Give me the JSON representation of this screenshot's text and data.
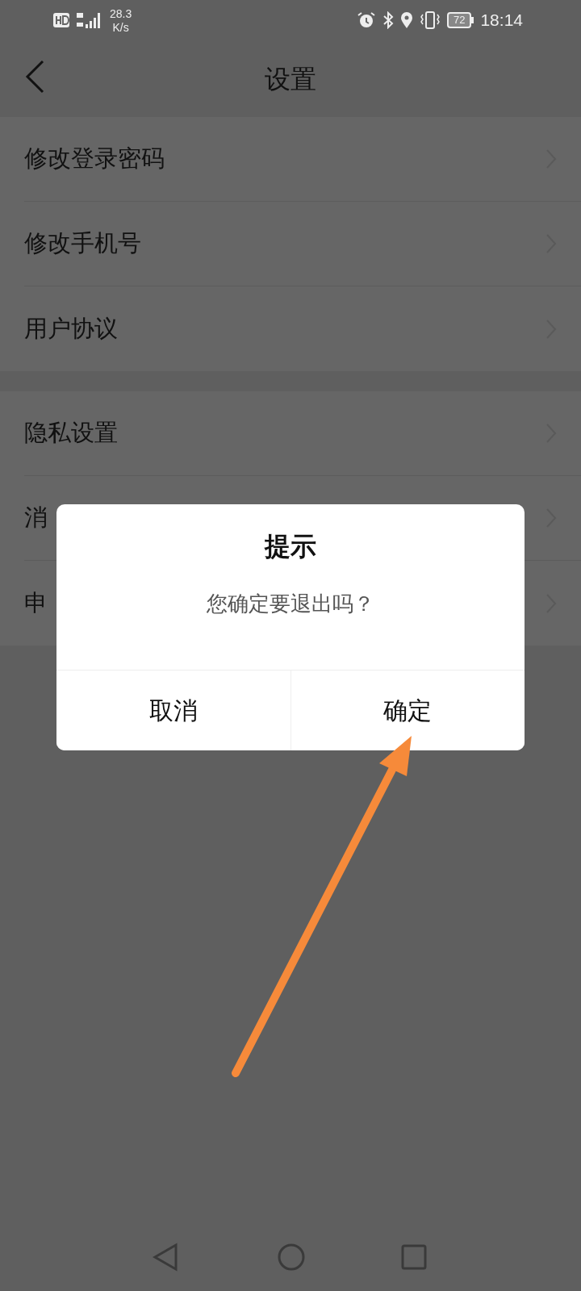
{
  "status_bar": {
    "speed": "28.3",
    "speed_unit": "K/s",
    "battery": "72",
    "time": "18:14"
  },
  "header": {
    "title": "设置"
  },
  "groups": [
    {
      "items": [
        {
          "label": "修改登录密码"
        },
        {
          "label": "修改手机号"
        },
        {
          "label": "用户协议"
        }
      ]
    },
    {
      "items": [
        {
          "label": "隐私设置"
        },
        {
          "label": "消"
        },
        {
          "label": "申"
        }
      ]
    }
  ],
  "dialog": {
    "title": "提示",
    "message": "您确定要退出吗？",
    "buttons": [
      {
        "label": "取消"
      },
      {
        "label": "确定"
      }
    ]
  }
}
